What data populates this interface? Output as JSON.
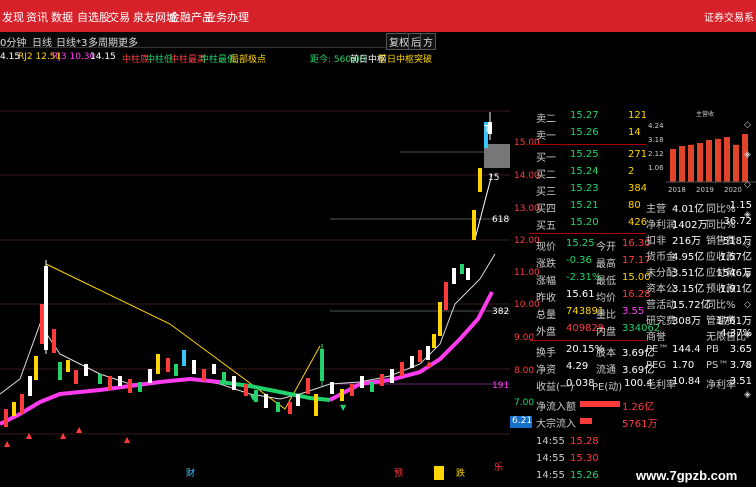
{
  "menu": [
    "发现",
    "资讯",
    "数据",
    "自选股",
    "交易",
    "泉友网城",
    "金融产品",
    "业务办理"
  ],
  "brand": "证券交易系",
  "toolbar": {
    "period1": "0分钟",
    "period2": "日线",
    "period3": "日线*3",
    "period4": "多周期",
    "more": "更多",
    "right1": "复权",
    "right2": "后",
    "right3": "方"
  },
  "infobar": {
    "items": [
      {
        "text": "4.15",
        "color": "#ffffff"
      },
      {
        "text": "RJ2 12.51",
        "color": "#ffd400"
      },
      {
        "text": "RJ3 10.30",
        "color": "#ff3bf0"
      },
      {
        "text": "14.15",
        "color": "#ffffff"
      },
      {
        "text": "中柱底",
        "color": "#ff3b3b"
      },
      {
        "text": "中柱低",
        "color": "#22d36b"
      },
      {
        "text": "中柱最高",
        "color": "#ff3b3b"
      },
      {
        "text": "中柱最低",
        "color": "#22d36b"
      },
      {
        "text": "局部极点",
        "color": "#ffd400"
      },
      {
        "text": "距今: 560.00",
        "color": "#22d36b"
      },
      {
        "text": "前日中枢",
        "color": "#ffffff"
      },
      {
        "text": "前日中枢突破",
        "color": "#ffd400"
      }
    ]
  },
  "chart_annotations": {
    "t_mark": "T",
    "p1": "15",
    "p2": "618",
    "p3": "382",
    "p4": "191",
    "price_label": "6.21",
    "bottom_labels": [
      "财",
      "预",
      "跌",
      "乐"
    ]
  },
  "price_axis": [
    "15.00",
    "14.00",
    "13.00",
    "12.00",
    "11.00",
    "10.00",
    "9.00",
    "8.00",
    "7.00"
  ],
  "order_book": [
    {
      "label": "卖二",
      "price": "15.27",
      "vol": "1217"
    },
    {
      "label": "卖一",
      "price": "15.26",
      "vol": "14"
    },
    {
      "label": "买一",
      "price": "15.25",
      "vol": "271"
    },
    {
      "label": "买二",
      "price": "15.24",
      "vol": "2"
    },
    {
      "label": "买三",
      "price": "15.23",
      "vol": "384"
    },
    {
      "label": "买四",
      "price": "15.21",
      "vol": "80"
    },
    {
      "label": "买五",
      "price": "15.20",
      "vol": "426"
    }
  ],
  "quote": [
    {
      "l1": "现价",
      "v1": "15.25",
      "l2": "今开",
      "v2": "16.30"
    },
    {
      "l1": "涨跌",
      "v1": "-0.36",
      "l2": "最高",
      "v2": "17.17"
    },
    {
      "l1": "涨幅",
      "v1": "-2.31%",
      "l2": "最低",
      "v2": "15.00"
    },
    {
      "l1": "昨收",
      "v1": "15.61",
      "l2": "均价",
      "v2": "16.28"
    },
    {
      "l1": "总量",
      "v1": "743891",
      "l2": "量比",
      "v2": "3.55"
    },
    {
      "l1": "外盘",
      "v1": "409829",
      "l2": "内盘",
      "v2": "334062"
    },
    {
      "l1": "换手",
      "v1": "20.15%",
      "l2": "股本",
      "v2": "3.69亿"
    },
    {
      "l1": "净资",
      "v1": "4.29",
      "l2": "流通",
      "v2": "3.69亿"
    },
    {
      "l1": "收益(一)",
      "v1": "0.038",
      "l2": "PE(动)",
      "v2": "100.4"
    }
  ],
  "flows": [
    {
      "label": "净流入额",
      "value": "1.26亿"
    },
    {
      "label": "大宗流入",
      "value": "5761万"
    }
  ],
  "ticks": [
    {
      "time": "14:55",
      "price": "15.28"
    },
    {
      "time": "14:55",
      "price": "15.30"
    },
    {
      "time": "14:55",
      "price": "15.26"
    }
  ],
  "fin_chart": {
    "ylabels": [
      "4.24",
      "3.18",
      "2.12",
      "1.06"
    ],
    "years": [
      "2018",
      "2019",
      "2020"
    ],
    "bars": [
      0.55,
      0.6,
      0.62,
      0.65,
      0.7,
      0.72,
      0.75,
      0.62,
      0.8
    ],
    "title": "主营收"
  },
  "fin_rows": [
    {
      "k": "主营",
      "a": "4.01亿",
      "b": "同比%",
      "c": "1.15"
    },
    {
      "k": "净利润",
      "a": "1402万",
      "b": "同比%",
      "c": "36.72"
    },
    {
      "k": "扣非",
      "a": "216万",
      "b": "销售费",
      "c": "518万"
    },
    {
      "k": "货币金",
      "a": "4.95亿",
      "b": "应收款",
      "c": "1.57亿"
    },
    {
      "k": "未分配",
      "a": "3.51亿",
      "b": "应付款",
      "c": "1546万"
    },
    {
      "k": "资本公",
      "a": "3.15亿",
      "b": "预收款",
      "c": "1.91亿"
    },
    {
      "k": "营活动",
      "a": "15.72亿",
      "b": "同比%",
      "c": ""
    },
    {
      "k": "研究费",
      "a": "308万",
      "b": "管理费",
      "c": "1761万"
    },
    {
      "k": "商誉",
      "a": "",
      "b": "无限售比",
      "c": "4.37%"
    },
    {
      "k": "PE™",
      "a": "144.4",
      "b": "PB",
      "c": "3.65"
    },
    {
      "k": "PEG",
      "a": "1.70",
      "b": "PS™",
      "c": "3.78"
    },
    {
      "k": "毛利率",
      "a": "10.84",
      "b": "净利率",
      "c": "3.51"
    }
  ],
  "watermark": "www.7gpzb.com"
}
